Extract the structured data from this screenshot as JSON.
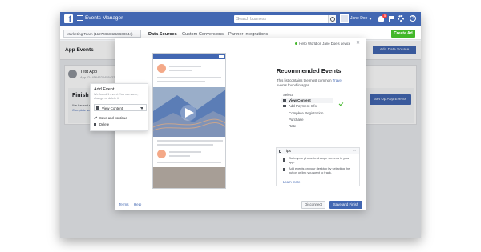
{
  "topbar": {
    "logo": "f",
    "app_title": "Events Manager",
    "search_placeholder": "Search business",
    "user_name": "Jane Doe",
    "notification_count": "5",
    "help": "?"
  },
  "subbar": {
    "account": "Marketing Team (112746584215660044)",
    "tabs": [
      "Data Sources",
      "Custom Conversions",
      "Partner Integrations"
    ],
    "create_ad_label": "Create Ad"
  },
  "page": {
    "title": "App Events",
    "add_data_source_label": "Add Data Source",
    "app_name": "Test App",
    "app_id": "App ID: 4564324455422..",
    "finish_title": "Finish Se",
    "finish_sub": "We haven't re",
    "finish_link": "Complete set",
    "setup_button": "Set Up App Events"
  },
  "popover": {
    "title": "Add Event",
    "description": "We found 1 event. You can save, change or delete it.",
    "selected": "View Content",
    "save_label": "Save and continue",
    "delete_label": "Delete"
  },
  "modal": {
    "device_status": "Hello World on Jane Doe's device",
    "close": "✕",
    "rec_title": "Recommended Events",
    "rec_desc_pre": "This list contains the most common",
    "rec_desc_link": "Travel",
    "rec_desc_post": "events found in apps.",
    "select_label": "Select",
    "options": [
      "View Content",
      "Add Payment Info",
      "Complete Registration",
      "Purchase",
      "Rate"
    ],
    "tips_title": "Tips",
    "tips_more": "...",
    "tip1": "Go to your phone to change screens in your app.",
    "tip2": "Add events on your desktop by selecting the button or link you want to track.",
    "learn_more": "Learn more",
    "terms": "Terms",
    "help": "Help",
    "disconnect": "Disconnect",
    "save_finish": "Save and Finish"
  },
  "colors": {
    "brand_blue": "#4267b2",
    "green": "#42b72a"
  }
}
